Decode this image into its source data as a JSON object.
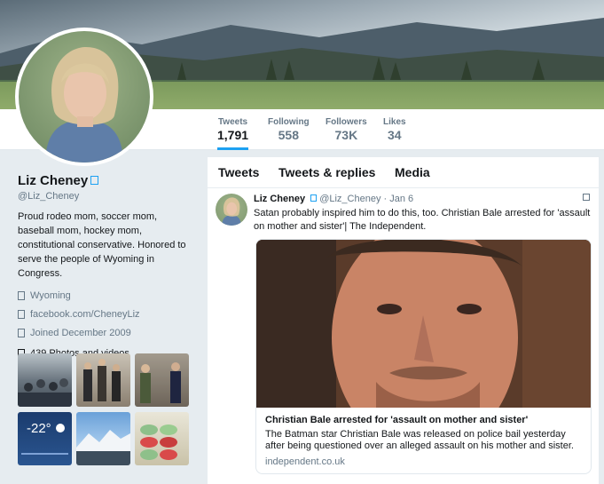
{
  "profile": {
    "name": "Liz Cheney",
    "handle": "@Liz_Cheney",
    "bio": "Proud rodeo mom, soccer mom, baseball mom, hockey mom, constitutional conservative. Honored to serve the people of Wyoming in Congress.",
    "location": "Wyoming",
    "website": "facebook.com/CheneyLiz",
    "joined": "Joined December 2009",
    "photos_label": "439 Photos and videos",
    "location_icon": "location-pin-icon",
    "link_icon": "link-icon",
    "calendar_icon": "calendar-icon",
    "photo_icon": "photo-icon",
    "verified_icon": "verified-badge-icon"
  },
  "stats": [
    {
      "label": "Tweets",
      "value": "1,791"
    },
    {
      "label": "Following",
      "value": "558"
    },
    {
      "label": "Followers",
      "value": "73K"
    },
    {
      "label": "Likes",
      "value": "34"
    }
  ],
  "tabs": [
    "Tweets",
    "Tweets & replies",
    "Media"
  ],
  "tweet": {
    "name": "Liz Cheney",
    "handle": "@Liz_Cheney",
    "separator": "·",
    "date": "Jan 6",
    "text": "Satan probably inspired him to do this, too.  Christian Bale arrested for 'assault on mother and sister'| The Independent.",
    "card": {
      "title": "Christian Bale arrested for 'assault on mother and sister'",
      "description": "The Batman star Christian Bale was released on police bail yesterday after being questioned over an alleged assault on his mother and sister.",
      "domain": "independent.co.uk"
    }
  },
  "thumbs": {
    "weather_temp": "-22°"
  },
  "colors": {
    "accent": "#1da1f2",
    "text": "#14171a",
    "muted": "#657786",
    "background": "#e6ecf0"
  }
}
